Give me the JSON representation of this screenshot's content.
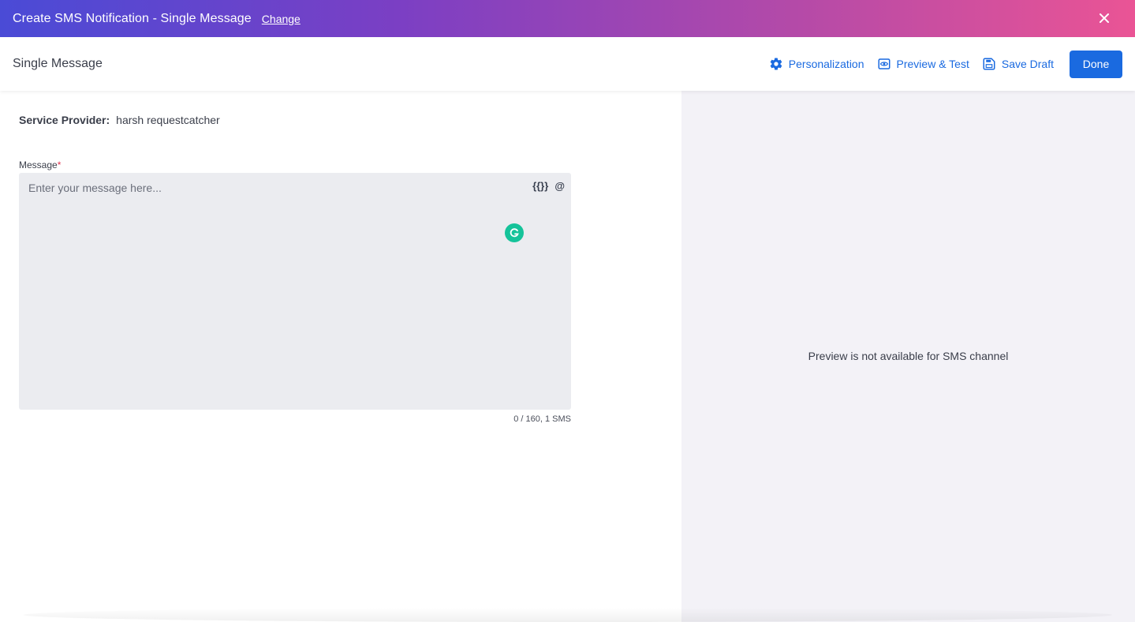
{
  "topbar": {
    "title": "Create SMS Notification - Single Message",
    "change_label": "Change",
    "close_icon": "close-icon"
  },
  "header": {
    "page_title": "Single Message",
    "actions": {
      "personalization": "Personalization",
      "preview_test": "Preview & Test",
      "save_draft": "Save Draft",
      "done": "Done"
    }
  },
  "form": {
    "service_provider_label": "Service Provider:",
    "service_provider_value": "harsh requestcatcher",
    "message_label": "Message",
    "required_mark": "*",
    "message_placeholder": "Enter your message here...",
    "message_value": "",
    "personalize_icon_text": "{{}}",
    "mention_icon_text": "@",
    "counter": "0 / 160, 1 SMS"
  },
  "preview": {
    "unavailable_text": "Preview is not available for SMS channel"
  },
  "colors": {
    "accent": "#1a6ae0",
    "topbar_start": "#4a4bd6",
    "topbar_end": "#ea5495",
    "preview_bg": "#f3f2f7",
    "message_bg": "#ebecf0"
  }
}
